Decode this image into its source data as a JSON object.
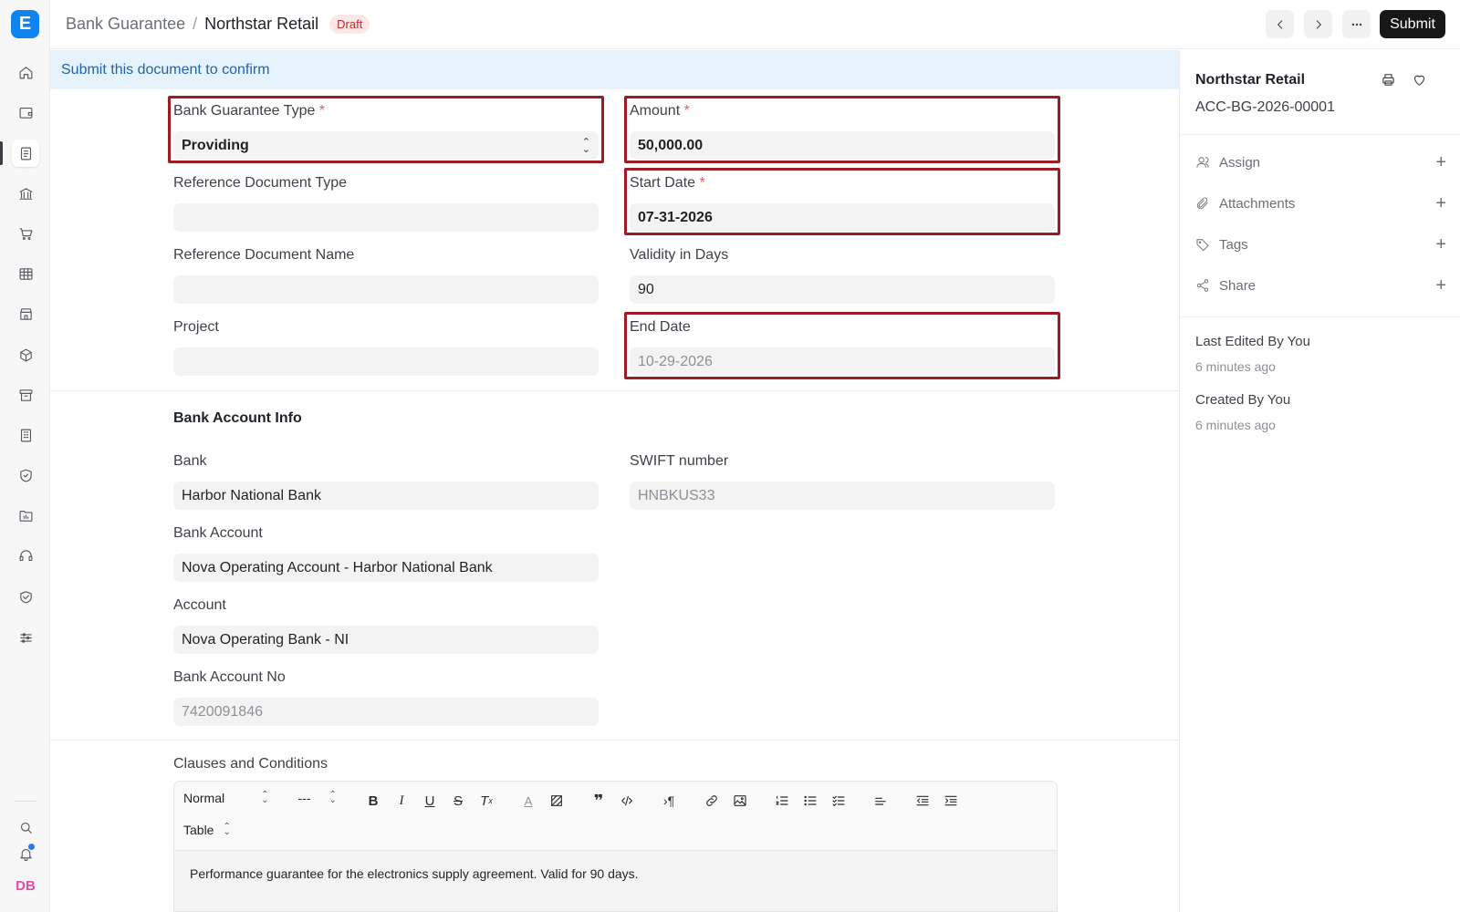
{
  "app": {
    "logo_letter": "E",
    "avatar_initials": "DB"
  },
  "breadcrumb": {
    "parent": "Bank Guarantee",
    "separator": "/",
    "current": "Northstar Retail",
    "status": "Draft"
  },
  "toolbar": {
    "submit_label": "Submit"
  },
  "alert": {
    "message": "Submit this document to confirm"
  },
  "form": {
    "bank_guarantee_type": {
      "label": "Bank Guarantee Type",
      "value": "Providing"
    },
    "reference_document_type": {
      "label": "Reference Document Type",
      "value": ""
    },
    "reference_document_name": {
      "label": "Reference Document Name",
      "value": ""
    },
    "project": {
      "label": "Project",
      "value": ""
    },
    "amount": {
      "label": "Amount",
      "value": "50,000.00"
    },
    "start_date": {
      "label": "Start Date",
      "value": "07-31-2026"
    },
    "validity_in_days": {
      "label": "Validity in Days",
      "value": "90"
    },
    "end_date": {
      "label": "End Date",
      "value": "10-29-2026"
    },
    "required_marker": "*"
  },
  "bank_section": {
    "title": "Bank Account Info",
    "bank": {
      "label": "Bank",
      "value": "Harbor National Bank"
    },
    "bank_account": {
      "label": "Bank Account",
      "value": "Nova Operating Account - Harbor National Bank"
    },
    "account": {
      "label": "Account",
      "value": "Nova Operating Bank - NI"
    },
    "bank_account_no": {
      "label": "Bank Account No",
      "value": "7420091846"
    },
    "swift_number": {
      "label": "SWIFT number",
      "value": "HNBKUS33"
    }
  },
  "clauses": {
    "label": "Clauses and Conditions",
    "format_select": "Normal",
    "size_select": "---",
    "table_select": "Table",
    "content": "Performance guarantee for the electronics supply agreement. Valid for 90 days."
  },
  "sidebar": {
    "title": "Northstar Retail",
    "doc_id": "ACC-BG-2026-00001",
    "actions": [
      {
        "label": "Assign",
        "icon": "user-icon"
      },
      {
        "label": "Attachments",
        "icon": "paperclip-icon"
      },
      {
        "label": "Tags",
        "icon": "tag-icon"
      },
      {
        "label": "Share",
        "icon": "share-icon"
      }
    ],
    "last_edited_label": "Last Edited By You",
    "last_edited_time": "6 minutes ago",
    "created_label": "Created By You",
    "created_time": "6 minutes ago"
  },
  "colors": {
    "highlight": "#9b1c22",
    "alert_bg": "#e6f3fc",
    "alert_text": "#1f64a9",
    "draft_bg": "#fde8e8",
    "draft_text": "#c5282c",
    "submit_bg": "#171717",
    "logo_bg": "#0d84f0"
  }
}
